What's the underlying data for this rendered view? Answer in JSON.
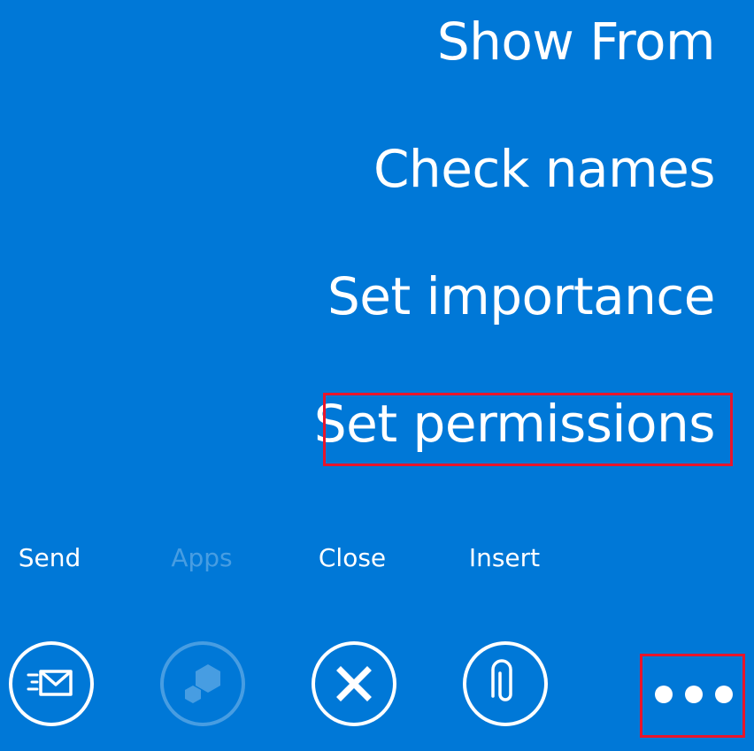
{
  "colors": {
    "background": "#0078D7",
    "foreground": "#FFFFFF",
    "highlight": "#E8152B"
  },
  "menu": {
    "items": [
      {
        "label": "Show From"
      },
      {
        "label": "Check names"
      },
      {
        "label": "Set importance"
      },
      {
        "label": "Set permissions"
      }
    ]
  },
  "appbar": {
    "buttons": [
      {
        "label": "Send",
        "icon": "send-mail-icon",
        "enabled": true
      },
      {
        "label": "Apps",
        "icon": "apps-hexagon-icon",
        "enabled": false
      },
      {
        "label": "Close",
        "icon": "close-x-icon",
        "enabled": true
      },
      {
        "label": "Insert",
        "icon": "paperclip-icon",
        "enabled": true
      }
    ],
    "more": {
      "icon": "more-ellipsis-icon"
    }
  }
}
